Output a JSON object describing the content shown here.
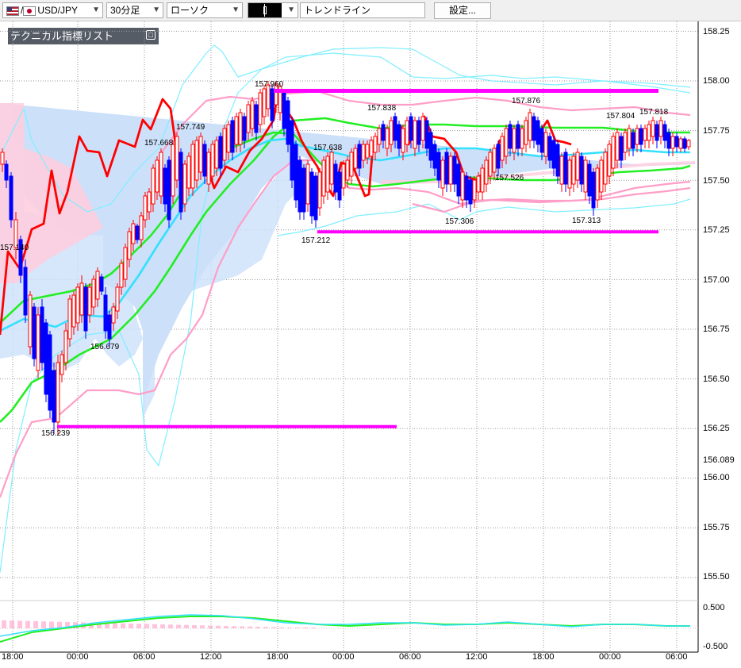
{
  "toolbar": {
    "symbol": "USD/JPY",
    "symbol_sep": "/",
    "timeframe": "30分足",
    "chart_type": "ローソク",
    "drawing_tool_icon": "candle-icon",
    "drawing_tool": "トレンドライン",
    "settings_label": "設定..."
  },
  "indicator_panel": {
    "title": "テクニカル指標リスト",
    "toggle": "□"
  },
  "colors": {
    "up_candle": "#ff0000",
    "down_candle": "#0000ff",
    "tenkan": "#ff0000",
    "ma_short": "#33e0ff",
    "ma_mid": "#22ee22",
    "bollinger_outer": "#7fefff",
    "bollinger_inner": "#ff9ec8",
    "cloud_blue": "#cce0fa",
    "cloud_pink": "#ffccdd",
    "trendline": "#ff00ff"
  },
  "chart_data": {
    "type": "candlestick",
    "symbol": "USD/JPY",
    "timeframe": "30分足",
    "y_axis": {
      "min": 155.37,
      "max": 158.3,
      "ticks": [
        "158.25",
        "158.00",
        "157.75",
        "157.50",
        "157.25",
        "157.00",
        "156.75",
        "156.50",
        "156.25",
        "156.00",
        "155.75",
        "155.50"
      ]
    },
    "current_price_label": "156.089",
    "x_axis": {
      "ticks": [
        "18:00",
        "00:00",
        "06:00",
        "12:00",
        "18:00",
        "00:00",
        "06:00",
        "12:00",
        "18:00",
        "00:00",
        "06:00"
      ]
    },
    "price_annotations": [
      {
        "text": "157.140",
        "value": 157.14
      },
      {
        "text": "156.239",
        "value": 156.239
      },
      {
        "text": "156.679",
        "value": 156.679
      },
      {
        "text": "157.668",
        "value": 157.668
      },
      {
        "text": "157.749",
        "value": 157.749
      },
      {
        "text": "157.960",
        "value": 157.96
      },
      {
        "text": "157.212",
        "value": 157.212
      },
      {
        "text": "157.638",
        "value": 157.638
      },
      {
        "text": "157.838",
        "value": 157.838
      },
      {
        "text": "157.306",
        "value": 157.306
      },
      {
        "text": "157.526",
        "value": 157.526
      },
      {
        "text": "157.876",
        "value": 157.876
      },
      {
        "text": "157.313",
        "value": 157.313
      },
      {
        "text": "157.804",
        "value": 157.804
      },
      {
        "text": "157.818",
        "value": 157.818
      }
    ],
    "horizontal_lines": [
      {
        "value": 157.95,
        "from": "18:00 day2",
        "to": "04:00 day4"
      },
      {
        "value": 157.24,
        "from": "00:00 day3",
        "to": "04:00 day4"
      },
      {
        "value": 156.26,
        "from": "00:00 day2",
        "to": "06:00 day3"
      }
    ],
    "oscillator": {
      "ticks": [
        "0.500",
        "-0.500"
      ]
    }
  }
}
